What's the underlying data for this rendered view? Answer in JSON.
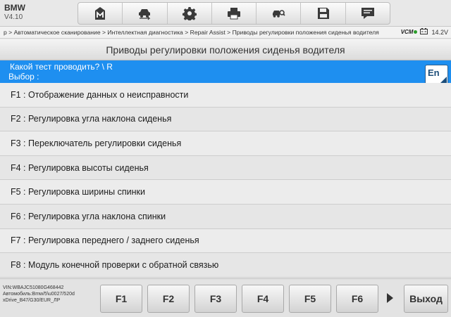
{
  "header": {
    "make": "BMW",
    "version": "V4.10",
    "toolbar": [
      {
        "icon": "home-icon"
      },
      {
        "icon": "vehicle-swap-icon"
      },
      {
        "icon": "gear-icon"
      },
      {
        "icon": "printer-icon"
      },
      {
        "icon": "car-search-icon"
      },
      {
        "icon": "save-icon"
      },
      {
        "icon": "message-icon"
      }
    ]
  },
  "breadcrumb": {
    "text": "р > Автоматическое сканирование > Интеллектная диагностика > Repair Assist > Приводы регулировки положения сиденья водителя",
    "vcm": "VCM",
    "voltage": "14.2V"
  },
  "title": "Приводы регулировки положения сиденья водителя",
  "prompt": {
    "line1": "Какой тест проводить? \\ R",
    "line2": "Выбор :",
    "translate_label": "En"
  },
  "items": [
    {
      "label": "F1 : Отображение данных о неисправности"
    },
    {
      "label": "F2 : Регулировка угла наклона сиденья"
    },
    {
      "label": "F3 : Переключатель регулировки сиденья"
    },
    {
      "label": "F4 : Регулировка высоты сиденья"
    },
    {
      "label": "F5 : Регулировка ширины спинки"
    },
    {
      "label": "F6 : Регулировка угла наклона спинки"
    },
    {
      "label": "F7 : Регулировка переднего / заднего сиденья"
    },
    {
      "label": "F8 : Модуль конечной проверки с обратной связью"
    }
  ],
  "footer": {
    "vin": "VIN:WBAJC51080G468442",
    "vehicle_line1": "Автомобиль:Bmw/5\\u0027/520d",
    "vehicle_line2": "xDrive_B47/G30/EUR_ЛР",
    "fkeys": [
      "F1",
      "F2",
      "F3",
      "F4",
      "F5",
      "F6"
    ],
    "exit_label": "Выход"
  }
}
